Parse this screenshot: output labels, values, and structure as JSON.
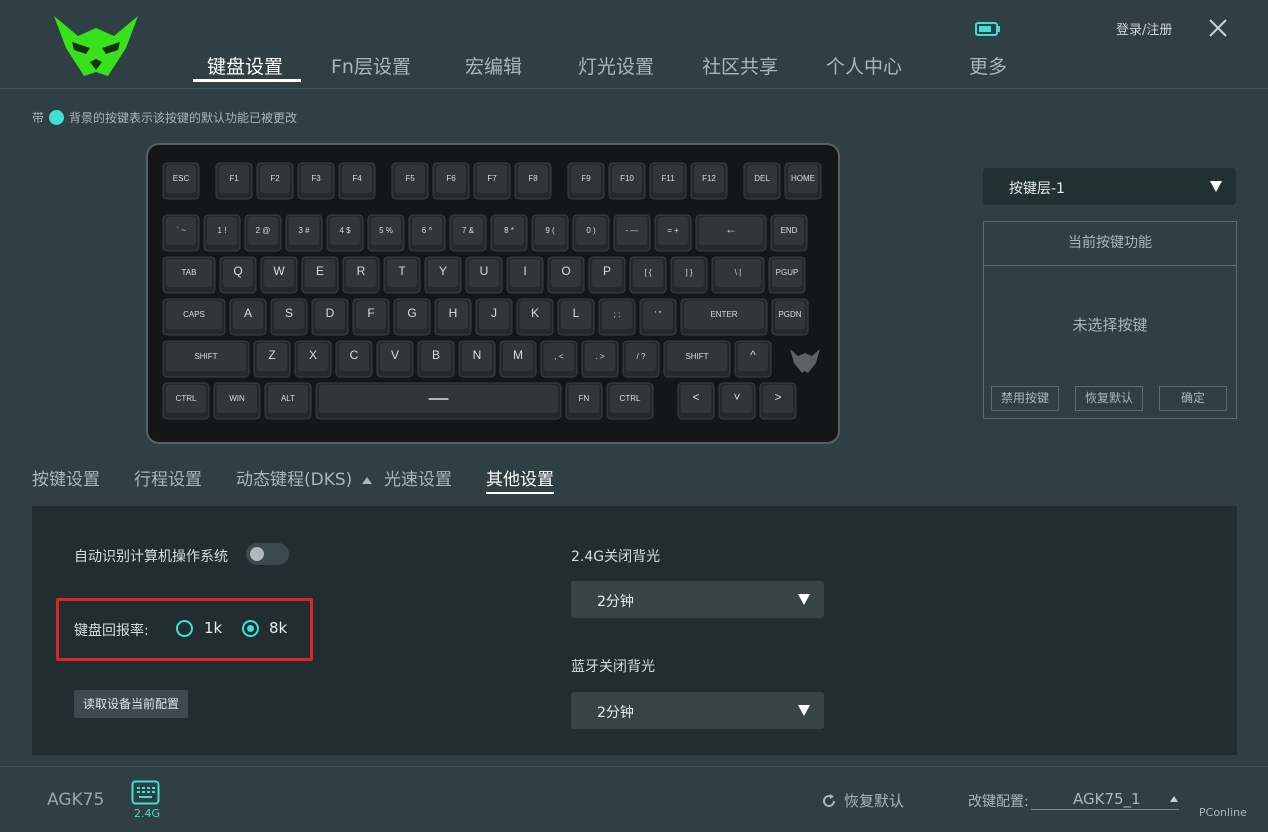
{
  "header": {
    "login_label": "登录/注册",
    "icons": {
      "logo": "wolf-logo-icon",
      "battery": "battery-icon",
      "close": "close-icon"
    },
    "nav": [
      {
        "label": "键盘设置",
        "active": true
      },
      {
        "label": "Fn层设置"
      },
      {
        "label": "宏编辑"
      },
      {
        "label": "灯光设置"
      },
      {
        "label": "社区共享"
      },
      {
        "label": "个人中心"
      },
      {
        "label": "更多"
      }
    ]
  },
  "legend": {
    "prefix": "带",
    "text": "背景的按键表示该按键的默认功能已被更改"
  },
  "keyboard": {
    "rows": [
      [
        "ESC",
        "F1",
        "F2",
        "F3",
        "F4",
        "F5",
        "F6",
        "F7",
        "F8",
        "F9",
        "F10",
        "F11",
        "F12",
        "DEL",
        "HOME"
      ],
      [
        "` ~",
        "1 !",
        "2 @",
        "3 #",
        "4 $",
        "5 %",
        "6 ^",
        "7 &",
        "8 *",
        "9 (",
        "0 )",
        "- —",
        "= +",
        "←",
        "END"
      ],
      [
        "TAB",
        "Q",
        "W",
        "E",
        "R",
        "T",
        "Y",
        "U",
        "I",
        "O",
        "P",
        "[ {",
        "] }",
        "\\ |",
        "PGUP"
      ],
      [
        "CAPS",
        "A",
        "S",
        "D",
        "F",
        "G",
        "H",
        "J",
        "K",
        "L",
        "; :",
        "' \"",
        "ENTER",
        "PGDN"
      ],
      [
        "SHIFT",
        "Z",
        "X",
        "C",
        "V",
        "B",
        "N",
        "M",
        ", <",
        ". >",
        "/ ?",
        "SHIFT",
        "^"
      ],
      [
        "CTRL",
        "WIN",
        "ALT",
        "—",
        "FN",
        "CTRL",
        "<",
        "˅",
        ">"
      ]
    ]
  },
  "layer_panel": {
    "selected_layer": "按键层-1",
    "func_header": "当前按键功能",
    "no_key": "未选择按键",
    "buttons": [
      "禁用按键",
      "恢复默认",
      "确定"
    ]
  },
  "subtabs": [
    {
      "label": "按键设置"
    },
    {
      "label": "行程设置"
    },
    {
      "label": "动态键程(DKS)"
    },
    {
      "label": "光速设置"
    },
    {
      "label": "其他设置",
      "active": true
    }
  ],
  "other_settings": {
    "auto_os_label": "自动识别计算机操作系统",
    "auto_os_enabled": false,
    "polling_label": "键盘回报率:",
    "polling_options": [
      "1k",
      "8k"
    ],
    "polling_selected": "8k",
    "read_button": "读取设备当前配置",
    "backlight_24g_label": "2.4G关闭背光",
    "backlight_24g_value": "2分钟",
    "backlight_bt_label": "蓝牙关闭背光",
    "backlight_bt_value": "2分钟"
  },
  "footer": {
    "device": "AGK75",
    "mode": "2.4G",
    "restore_label": "恢复默认",
    "config_label": "改键配置:",
    "config_value": "AGK75_1",
    "watermark": "PConline"
  },
  "colors": {
    "accent": "#3fe0d0",
    "highlight_box": "#dc2626",
    "logo_green": "#38e21a",
    "background": "#2f3f43"
  }
}
